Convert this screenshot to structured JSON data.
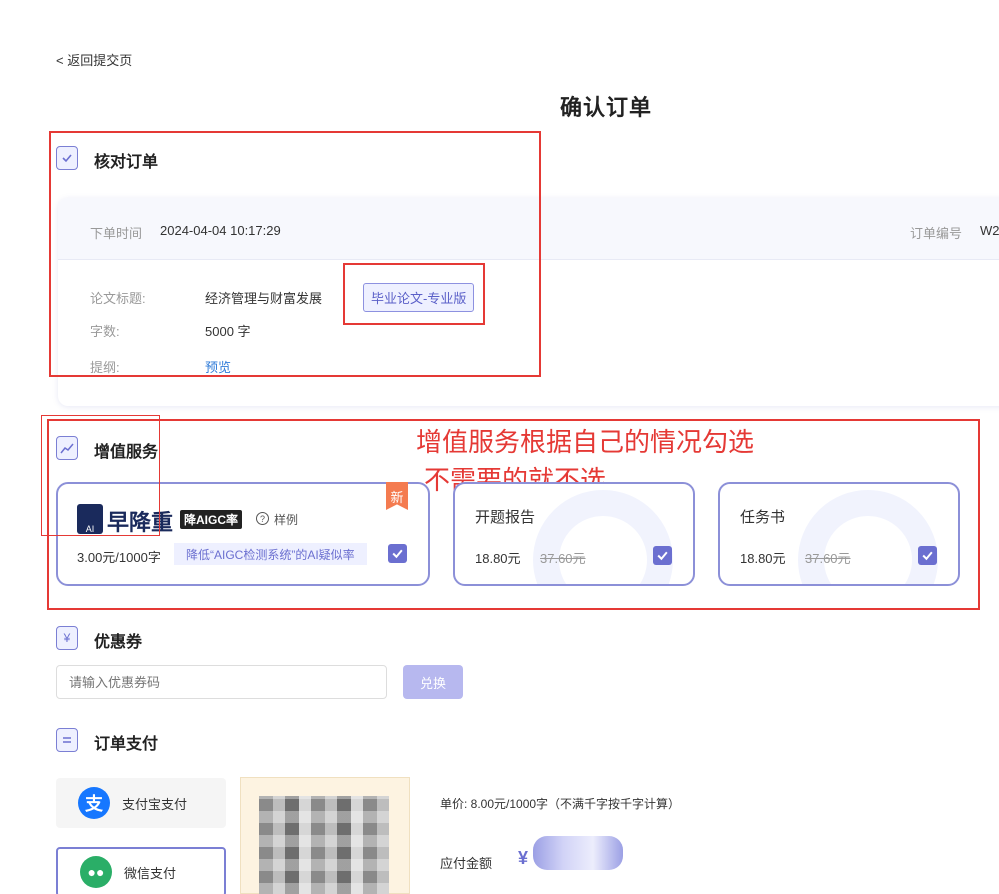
{
  "back_label": "< 返回提交页",
  "page_title": "确认订单",
  "check_section": {
    "title": "核对订单",
    "order_time_label": "下单时间",
    "order_time": "2024-04-04 10:17:29",
    "order_no_label": "订单编号",
    "order_no": "W2",
    "paper_title_label": "论文标题:",
    "paper_title": "经济管理与财富发展",
    "paper_type_badge": "毕业论文-专业版",
    "word_count_label": "字数:",
    "word_count": "5000 字",
    "outline_label": "提纲:",
    "outline_link": "预览"
  },
  "vas_section": {
    "title": "增值服务",
    "annotation_line1": "增值服务根据自己的情况勾选",
    "annotation_line2": "不需要的就不选",
    "services": [
      {
        "logo_text": "早降重",
        "tag": "降AIGC率",
        "sample_label": "样例",
        "new_badge": "新",
        "price": "3.00元/1000字",
        "desc": "降低“AIGC检测系统”的AI疑似率",
        "checked": true
      },
      {
        "name": "开题报告",
        "price": "18.80元",
        "original_price": "37.60元",
        "checked": true
      },
      {
        "name": "任务书",
        "price": "18.80元",
        "original_price": "37.60元",
        "checked": true
      }
    ]
  },
  "coupon_section": {
    "title": "优惠券",
    "input_placeholder": "请输入优惠券码",
    "button": "兑换"
  },
  "pay_section": {
    "title": "订单支付",
    "methods": [
      "支付宝支付",
      "微信支付"
    ],
    "unit_price": "单价: 8.00元/1000字（不满千字按千字计算）",
    "amount_label": "应付金额",
    "currency": "¥"
  },
  "colors": {
    "accent": "#6b6fd0",
    "annotation_red": "#e53935",
    "alipay_blue": "#1677ff",
    "wechat_green": "#2aae67"
  }
}
